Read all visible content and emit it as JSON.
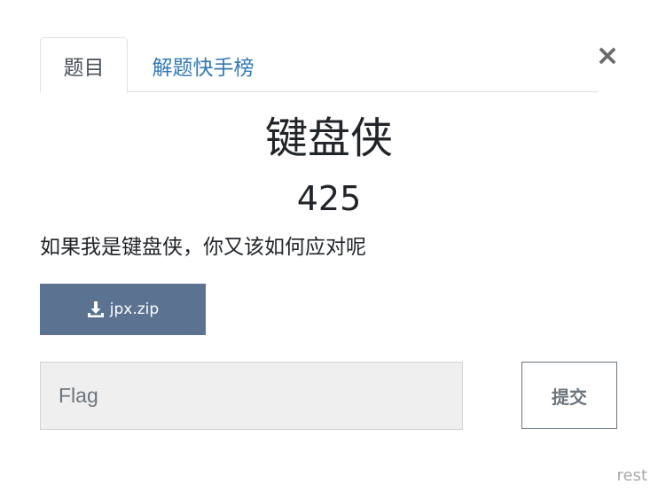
{
  "tabs": {
    "challenge_label": "题目",
    "solves_label": "解题快手榜"
  },
  "close_glyph": "×",
  "challenge": {
    "name": "键盘侠",
    "points": "425",
    "description": "如果我是键盘侠，你又该如何应对呢",
    "file_name": "jpx.zip",
    "file_icon": "download-icon"
  },
  "flag_form": {
    "placeholder": "Flag",
    "value": "",
    "submit_label": "提交"
  },
  "corner_text": "rest",
  "colors": {
    "link": "#337ab7",
    "file_button": "#5b7290",
    "input_bg": "#efefef",
    "submit_border": "#6c757d"
  }
}
